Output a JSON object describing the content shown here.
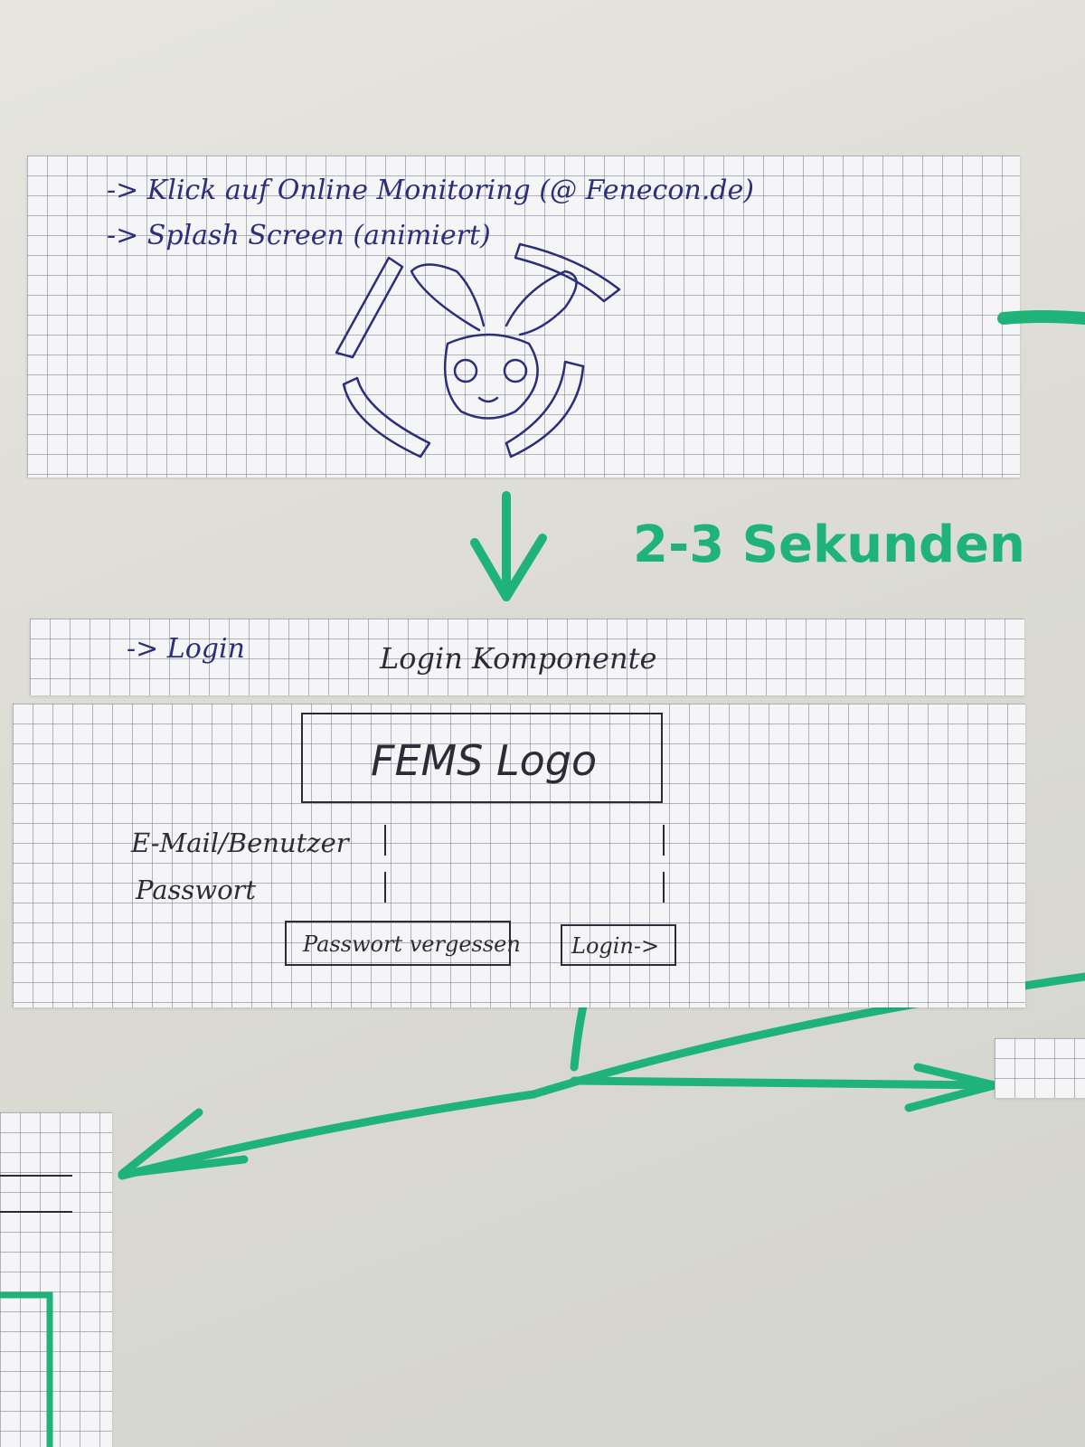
{
  "splash_note": {
    "line1": "-> Klick auf Online Monitoring (@ Fenecon.de)",
    "line2": "-> Splash Screen (animiert)"
  },
  "timing_label": "2-3 Sekunden",
  "login_header": {
    "arrow_label": "-> Login",
    "title": "Login Komponente"
  },
  "login_form": {
    "logo_placeholder": "FEMS Logo",
    "email_label": "E-Mail/Benutzer",
    "password_label": "Passwort",
    "forgot_button": "Passwort vergessen",
    "login_button": "Login->"
  },
  "colors": {
    "marker_green": "#1fb37a",
    "pen_blue": "#2b2f7a"
  }
}
